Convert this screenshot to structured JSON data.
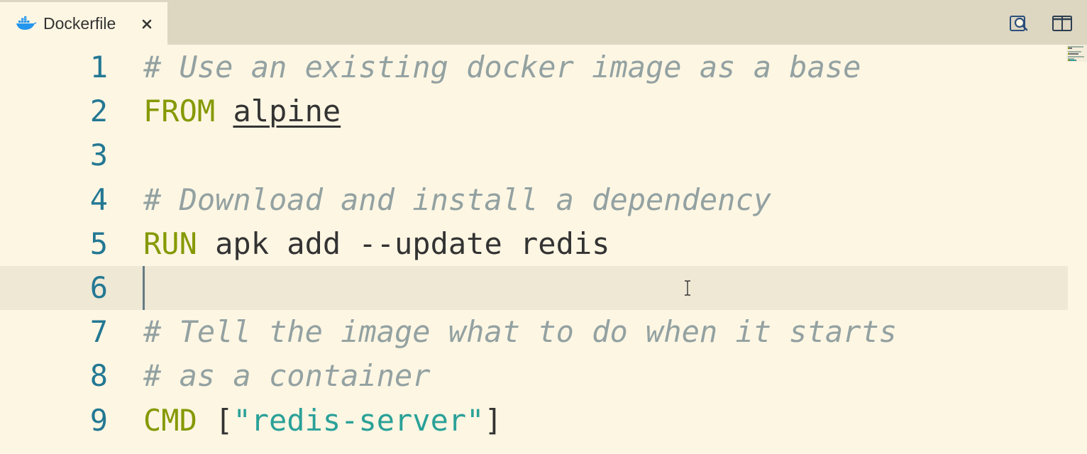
{
  "tab": {
    "label": "Dockerfile",
    "icon": "docker-icon",
    "close_icon": "close-icon"
  },
  "toolbar": {
    "find_references_icon": "find-references-icon",
    "split_editor_icon": "split-editor-icon"
  },
  "editor": {
    "current_line": 6,
    "lines": [
      {
        "number": "1",
        "tokens": [
          {
            "type": "comment",
            "text": "# Use an existing docker image as a base"
          }
        ]
      },
      {
        "number": "2",
        "tokens": [
          {
            "type": "keyword",
            "text": "FROM"
          },
          {
            "type": "plain",
            "text": " "
          },
          {
            "type": "link",
            "text": "alpine"
          }
        ]
      },
      {
        "number": "3",
        "tokens": []
      },
      {
        "number": "4",
        "tokens": [
          {
            "type": "comment",
            "text": "# Download and install a dependency"
          }
        ]
      },
      {
        "number": "5",
        "tokens": [
          {
            "type": "keyword",
            "text": "RUN"
          },
          {
            "type": "plain",
            "text": " apk add --update redis"
          }
        ]
      },
      {
        "number": "6",
        "tokens": []
      },
      {
        "number": "7",
        "tokens": [
          {
            "type": "comment",
            "text": "# Tell the image what to do when it starts"
          }
        ]
      },
      {
        "number": "8",
        "tokens": [
          {
            "type": "comment",
            "text": "# as a container"
          }
        ]
      },
      {
        "number": "9",
        "tokens": [
          {
            "type": "keyword",
            "text": "CMD"
          },
          {
            "type": "plain",
            "text": " ["
          },
          {
            "type": "string",
            "text": "\"redis-server\""
          },
          {
            "type": "plain",
            "text": "]"
          }
        ]
      }
    ]
  },
  "colors": {
    "background": "#fdf6e3",
    "tabbar": "#ddd6c1",
    "current_line": "#eee8d5",
    "line_number": "#237893",
    "comment": "#93a1a1",
    "keyword": "#859900",
    "string": "#2aa198",
    "text": "#333333",
    "docker_blue": "#2496ed"
  }
}
